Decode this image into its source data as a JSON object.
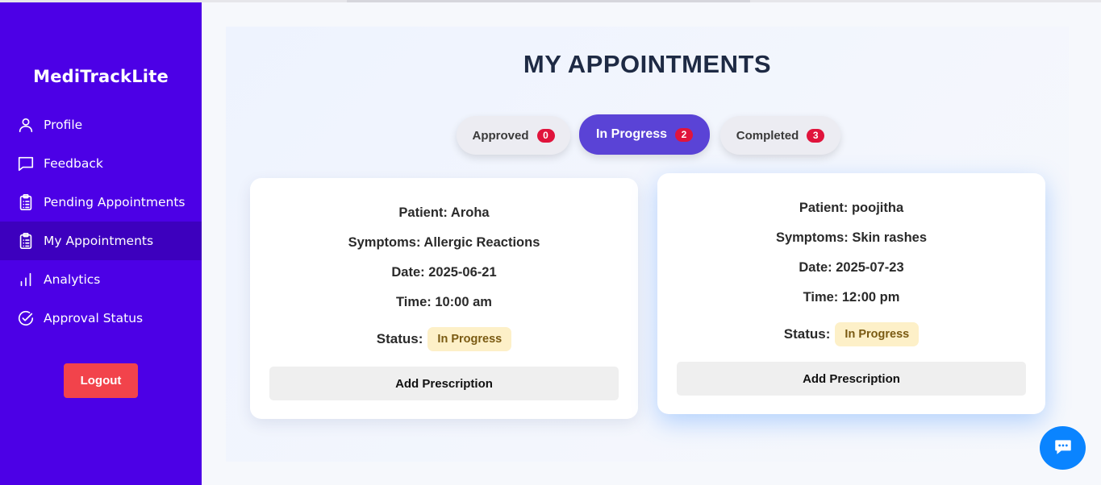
{
  "app": {
    "brand": "MediTrackLite"
  },
  "sidebar": {
    "items": [
      {
        "label": "Profile",
        "icon": "user-icon"
      },
      {
        "label": "Feedback",
        "icon": "message-square-icon"
      },
      {
        "label": "Pending Appointments",
        "icon": "clipboard-list-icon"
      },
      {
        "label": "My Appointments",
        "icon": "clipboard-list-icon",
        "active": true
      },
      {
        "label": "Analytics",
        "icon": "bar-chart-icon"
      },
      {
        "label": "Approval Status",
        "icon": "check-circle-icon"
      }
    ],
    "logout_label": "Logout"
  },
  "main": {
    "title": "MY APPOINTMENTS",
    "tabs": [
      {
        "label": "Approved",
        "count": "0"
      },
      {
        "label": "In Progress",
        "count": "2",
        "active": true
      },
      {
        "label": "Completed",
        "count": "3"
      }
    ],
    "appointments": [
      {
        "patient": "Patient: Aroha",
        "symptoms": "Symptoms: Allergic Reactions",
        "date": "Date: 2025-06-21",
        "time": "Time: 10:00 am",
        "status_label": "Status:",
        "status": "In Progress",
        "action": "Add Prescription"
      },
      {
        "patient": "Patient: poojitha",
        "symptoms": "Symptoms: Skin rashes",
        "date": "Date: 2025-07-23",
        "time": "Time: 12:00 pm",
        "status_label": "Status:",
        "status": "In Progress",
        "action": "Add Prescription"
      }
    ]
  },
  "chat": {
    "icon": "chat-bubble-icon"
  },
  "colors": {
    "sidebar": "#4c00e6",
    "sidebar_active": "#3d00be",
    "accent_tab": "#5a43d6",
    "badge": "#e0143c",
    "logout": "#f2434b",
    "status_pill": "#fdf0c8",
    "chat": "#0a84ff"
  }
}
